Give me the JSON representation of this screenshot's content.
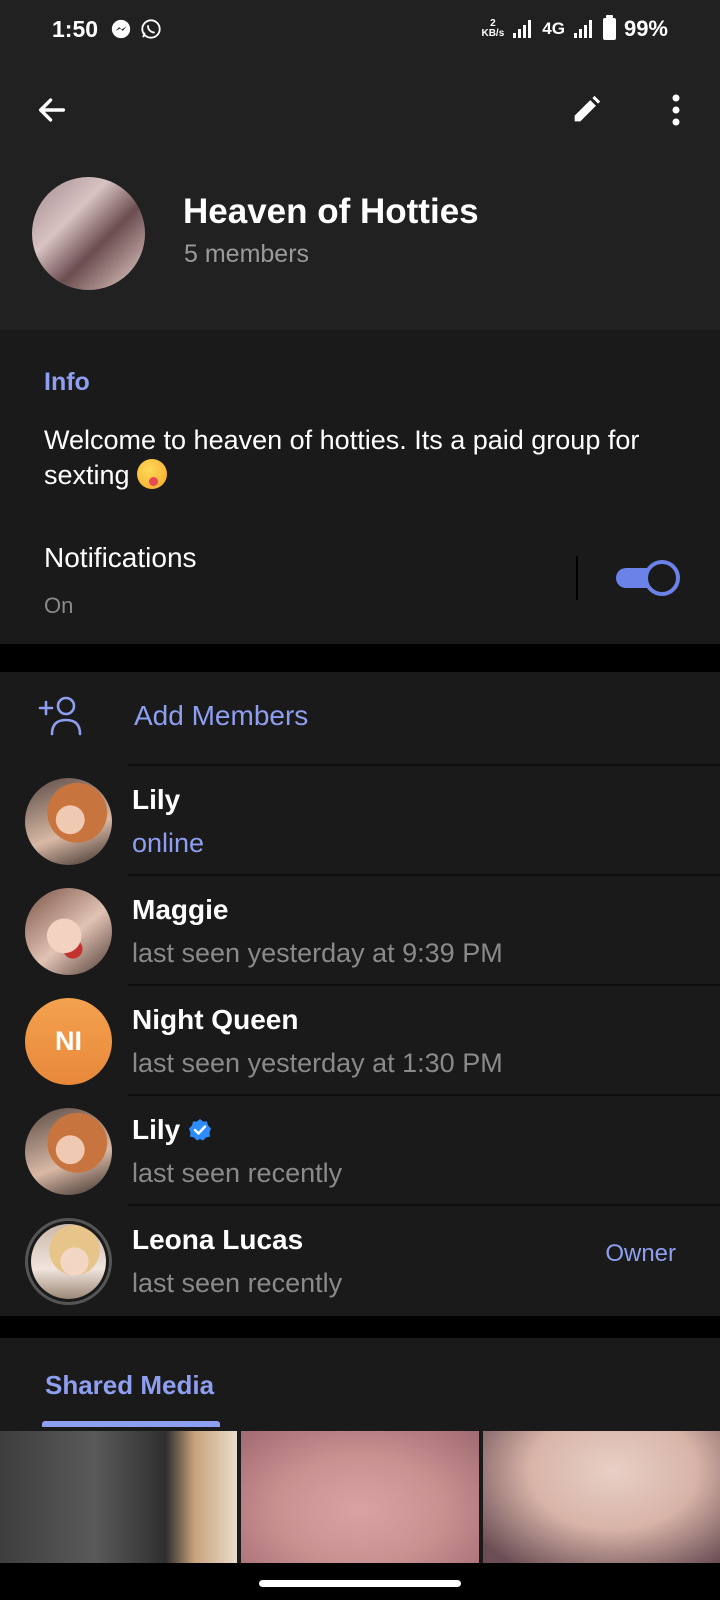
{
  "status_bar": {
    "time": "1:50",
    "speed_value": "2",
    "speed_unit": "KB/s",
    "network": "4G",
    "battery": "99%"
  },
  "header": {
    "group_name": "Heaven of Hotties",
    "members_count": "5 members"
  },
  "info": {
    "label": "Info",
    "description": "Welcome to heaven of hotties. Its a paid group for sexting",
    "notifications_label": "Notifications",
    "notifications_value": "On",
    "notifications_enabled": true
  },
  "members": {
    "add_label": "Add Members",
    "list": [
      {
        "name": "Lily",
        "status": "online"
      },
      {
        "name": "Maggie",
        "status": "last seen yesterday at 9:39 PM"
      },
      {
        "name": "Night Queen",
        "initials": "NI",
        "status": "last seen yesterday at 1:30 PM"
      },
      {
        "name": "Lily",
        "status": "last seen recently",
        "verified": true
      },
      {
        "name": "Leona Lucas",
        "status": "last seen recently",
        "role": "Owner"
      }
    ]
  },
  "media": {
    "tab_label": "Shared Media"
  },
  "colors": {
    "accent": "#8e9ef0",
    "toggle": "#6b82e8",
    "background": "#1a1a1a",
    "header": "#212121",
    "avatar_orange": "#f3a24f"
  }
}
